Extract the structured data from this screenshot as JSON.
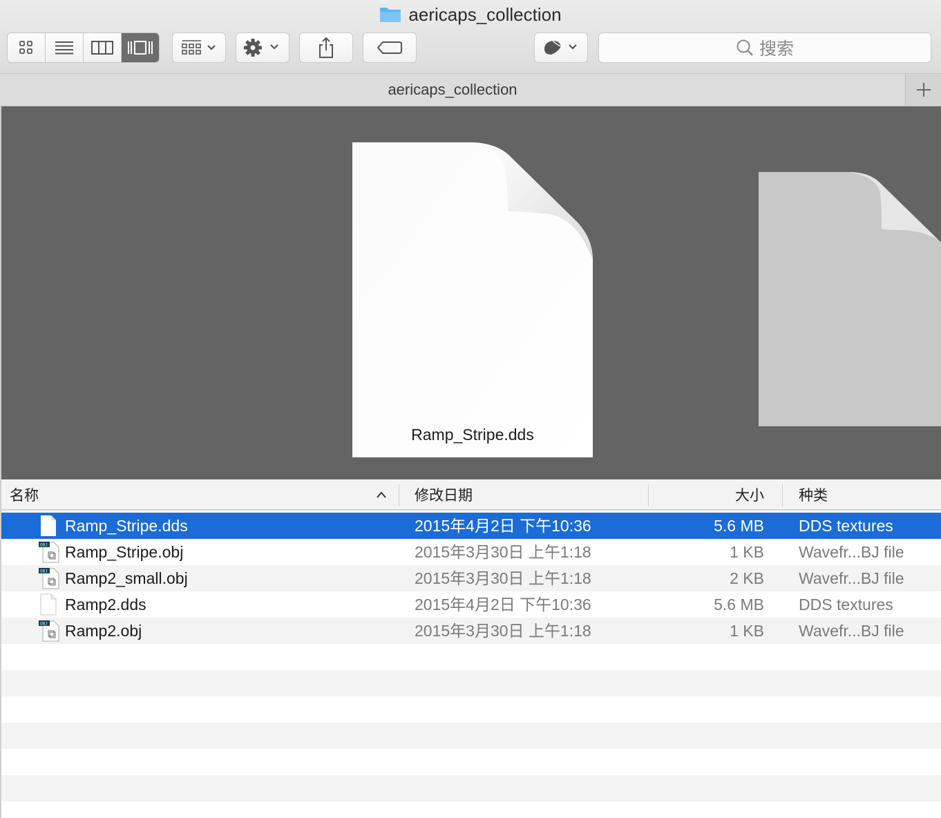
{
  "window": {
    "title": "aericaps_collection"
  },
  "toolbar": {
    "views": [
      "icon-view",
      "list-view",
      "column-view",
      "coverflow-view"
    ],
    "active_view": "coverflow-view",
    "search_placeholder": "搜索"
  },
  "tab": {
    "title": "aericaps_collection"
  },
  "preview": {
    "label": "Ramp_Stripe.dds"
  },
  "columns": {
    "name": "名称",
    "date": "修改日期",
    "size": "大小",
    "kind": "种类"
  },
  "files": [
    {
      "name": "Ramp_Stripe.dds",
      "date": "2015年4月2日 下午10:36",
      "size": "5.6 MB",
      "kind": "DDS textures",
      "icon": "blank-document-icon",
      "selected": true
    },
    {
      "name": "Ramp_Stripe.obj",
      "date": "2015年3月30日 上午1:18",
      "size": "1 KB",
      "kind": "Wavefr...BJ file",
      "icon": "obj-file-icon",
      "selected": false
    },
    {
      "name": "Ramp2_small.obj",
      "date": "2015年3月30日 上午1:18",
      "size": "2 KB",
      "kind": "Wavefr...BJ file",
      "icon": "obj-file-icon",
      "selected": false
    },
    {
      "name": "Ramp2.dds",
      "date": "2015年4月2日 下午10:36",
      "size": "5.6 MB",
      "kind": "DDS textures",
      "icon": "blank-document-icon",
      "selected": false
    },
    {
      "name": "Ramp2.obj",
      "date": "2015年3月30日 上午1:18",
      "size": "1 KB",
      "kind": "Wavefr...BJ file",
      "icon": "obj-file-icon",
      "selected": false
    }
  ],
  "colors": {
    "selection": "#1b6cd6",
    "coverflow_bg": "#646464",
    "folder": "#5fb3ef"
  }
}
